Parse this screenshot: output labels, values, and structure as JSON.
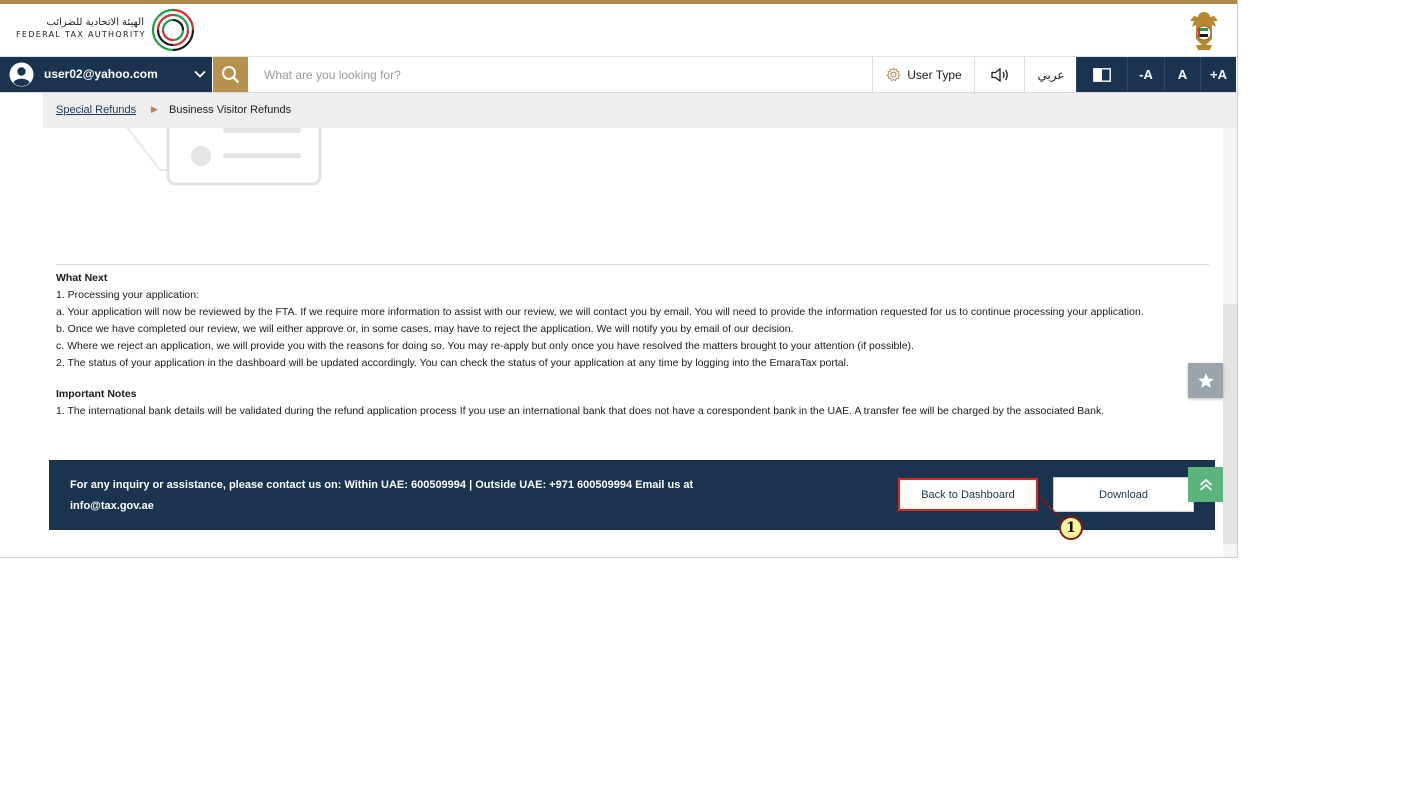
{
  "brand": {
    "name_ar": "الهيئة الاتحادية للضرائب",
    "name_en": "FEDERAL TAX AUTHORITY"
  },
  "navbar": {
    "user_email": "user02@yahoo.com",
    "search_placeholder": "What are you looking for?",
    "user_type_label": "User Type",
    "language_label": "عربي",
    "font_decrease": "-A",
    "font_normal": "A",
    "font_increase": "+A"
  },
  "breadcrumb": {
    "parent": "Special Refunds",
    "current": "Business Visitor Refunds"
  },
  "what_next": {
    "heading": "What Next",
    "lines": [
      "1. Processing your application:",
      " a. Your application will now be reviewed by the FTA. If we require more information to assist with our review, we will contact you by email. You will need to provide the information requested for us to continue processing your application.",
      " b. Once we have completed our review, we will either approve or, in some cases, may have to reject the application. We will notify you by email of our decision.",
      " c. Where we reject an application, we will provide you with the reasons for doing so. You may re-apply but only once you have resolved the matters brought to your attention (if possible).",
      "2. The status of your application in the dashboard will be updated accordingly. You can check the status of your application at any time by logging into the EmaraTax portal."
    ]
  },
  "important_notes": {
    "heading": "Important Notes",
    "lines": [
      " 1. The international bank details will be validated during the refund application process If you use an international bank that does not have a corespondent bank in the UAE. A transfer fee will be charged by the associated Bank."
    ]
  },
  "footer": {
    "contact_text": "For any inquiry or assistance, please contact us on: Within UAE: 600509994 | Outside UAE: +971 600509994 Email us at info@tax.gov.ae",
    "back_label": "Back to Dashboard",
    "download_label": "Download"
  },
  "annotation": {
    "badge": "1"
  },
  "colors": {
    "navy": "#1a3450",
    "gold": "#b7924f",
    "highlight_red": "#e0241b",
    "scroll_top_green": "#5ab47c"
  },
  "icons": {
    "user": "user-circle-icon",
    "chevron": "chevron-down-icon",
    "search": "search-icon",
    "settings": "gear-icon",
    "speaker": "speaker-icon",
    "contrast": "contrast-icon",
    "star": "star-icon",
    "scroll_top": "double-chevron-up-icon"
  }
}
